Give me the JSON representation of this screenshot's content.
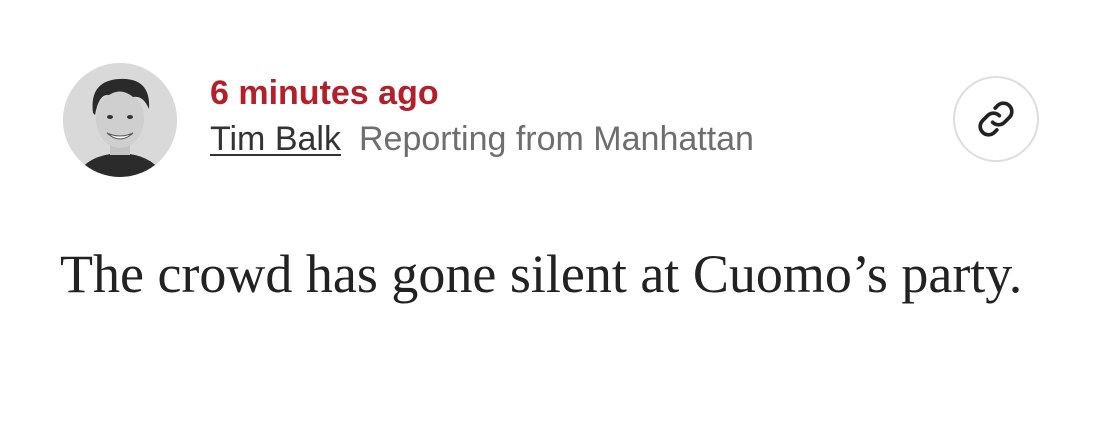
{
  "post": {
    "timestamp": "6 minutes ago",
    "author_name": "Tim Balk",
    "location": "Reporting from Manhattan",
    "body": "The crowd has gone silent at Cuomo’s party."
  },
  "icons": {
    "avatar": "author-photo",
    "share": "link-icon"
  },
  "colors": {
    "timestamp": "#b3202a",
    "author": "#333333",
    "location": "#6e6e6e",
    "body": "#222222",
    "button_border": "#dedede"
  }
}
